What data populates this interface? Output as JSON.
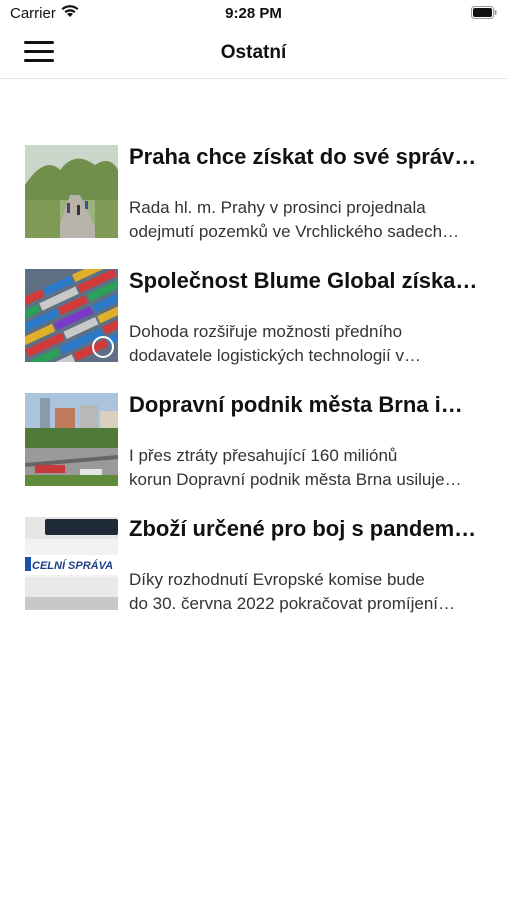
{
  "status_bar": {
    "carrier": "Carrier",
    "time": "9:28 PM"
  },
  "nav": {
    "title": "Ostatní",
    "menu_icon": "hamburger-icon"
  },
  "articles": [
    {
      "headline": "Praha chce získat do své správy…",
      "excerpt_line1": "Rada hl. m. Prahy v prosinci projednala",
      "excerpt_line2": "odejmutí pozemků ve Vrchlického sadech…",
      "thumb": "park-path-photo"
    },
    {
      "headline": "Společnost Blume Global získala…",
      "excerpt_line1": "Dohoda rozšiřuje možnosti předního",
      "excerpt_line2": "dodavatele logistických technologií v…",
      "thumb": "container-port-photo"
    },
    {
      "headline": "Dopravní podnik města Brna i…",
      "excerpt_line1": "I přes ztráty přesahující 160 miliónů",
      "excerpt_line2": "korun Dopravní podnik města Brna usiluje…",
      "thumb": "city-tram-photo"
    },
    {
      "headline": "Zboží určené pro boj s pandemií…",
      "excerpt_line1": "Díky rozhodnutí Evropské komise bude",
      "excerpt_line2": "do 30. června 2022 pokračovat promíjení…",
      "thumb": "customs-van-photo",
      "thumb_text": "CELNÍ SPRÁVA"
    }
  ]
}
